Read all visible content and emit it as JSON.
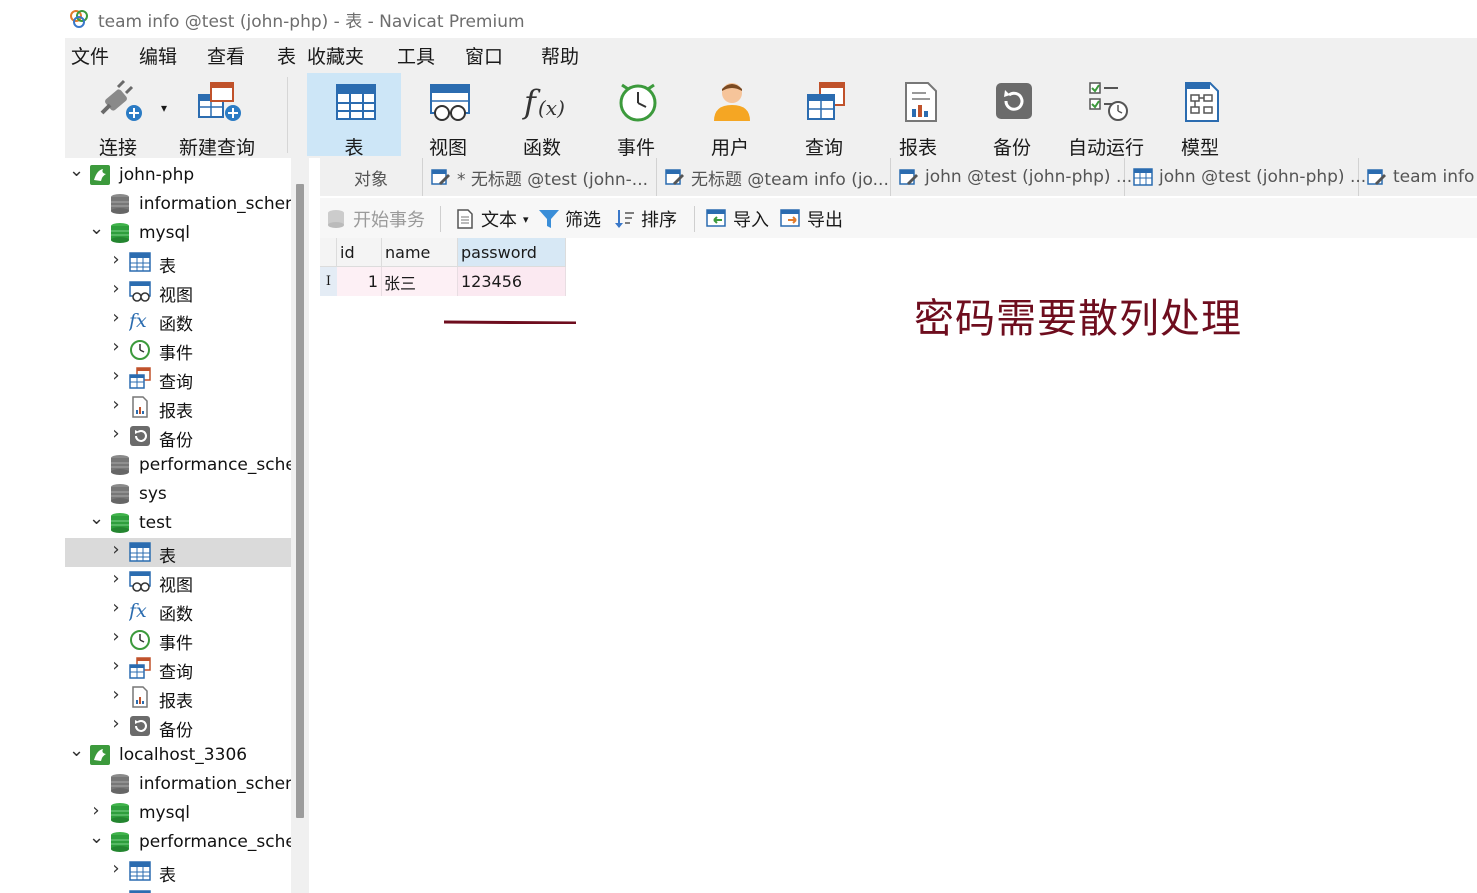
{
  "window": {
    "title": "team info @test (john-php) - 表 - Navicat Premium"
  },
  "menu": [
    "文件",
    "编辑",
    "查看",
    "表",
    "收藏夹",
    "工具",
    "窗口",
    "帮助"
  ],
  "toolbar": {
    "connect": "连接",
    "new_query": "新建查询",
    "table": "表",
    "view": "视图",
    "function": "函数",
    "event": "事件",
    "user": "用户",
    "query": "查询",
    "report": "报表",
    "backup": "备份",
    "autorun": "自动运行",
    "model": "模型"
  },
  "sidebar": {
    "items": [
      {
        "label": "john-php",
        "icon": "connection-icon"
      },
      {
        "label": "information_schem",
        "icon": "database-icon"
      },
      {
        "label": "mysql",
        "icon": "database-open-icon"
      },
      {
        "label": "表",
        "icon": "table-icon"
      },
      {
        "label": "视图",
        "icon": "view-icon"
      },
      {
        "label": "函数",
        "icon": "function-icon"
      },
      {
        "label": "事件",
        "icon": "event-icon"
      },
      {
        "label": "查询",
        "icon": "query-icon"
      },
      {
        "label": "报表",
        "icon": "report-icon"
      },
      {
        "label": "备份",
        "icon": "backup-icon"
      },
      {
        "label": "performance_scher",
        "icon": "database-icon"
      },
      {
        "label": "sys",
        "icon": "database-icon"
      },
      {
        "label": "test",
        "icon": "database-open-icon"
      },
      {
        "label": "表",
        "icon": "table-icon"
      },
      {
        "label": "视图",
        "icon": "view-icon"
      },
      {
        "label": "函数",
        "icon": "function-icon"
      },
      {
        "label": "事件",
        "icon": "event-icon"
      },
      {
        "label": "查询",
        "icon": "query-icon"
      },
      {
        "label": "报表",
        "icon": "report-icon"
      },
      {
        "label": "备份",
        "icon": "backup-icon"
      },
      {
        "label": "localhost_3306",
        "icon": "connection-icon"
      },
      {
        "label": "information_schem",
        "icon": "database-icon"
      },
      {
        "label": "mysql",
        "icon": "database-open-icon"
      },
      {
        "label": "performance_scher",
        "icon": "database-open-icon"
      },
      {
        "label": "表",
        "icon": "table-icon"
      },
      {
        "label": "视图",
        "icon": "view-icon"
      }
    ]
  },
  "tabs": [
    {
      "label": "对象"
    },
    {
      "label": "* 无标题 @test (john-..."
    },
    {
      "label": "无标题 @team info (jo..."
    },
    {
      "label": "john @test (john-php) ..."
    },
    {
      "label": "john @test (john-php) ..."
    },
    {
      "label": "team info @"
    }
  ],
  "data_toolbar": {
    "begin_transaction": "开始事务",
    "text": "文本",
    "filter": "筛选",
    "sort": "排序",
    "import": "导入",
    "export": "导出"
  },
  "grid": {
    "columns": [
      "id",
      "name",
      "password"
    ],
    "rows": [
      {
        "marker": "I",
        "id": "1",
        "name": "张三",
        "password": "123456"
      }
    ]
  },
  "annotation": {
    "text": "密码需要散列处理"
  },
  "colors": {
    "accent_blue": "#2b6cb0",
    "db_green": "#2e9e3c",
    "annotation_red": "#6e0d1e",
    "selected_row": "#dadada"
  }
}
